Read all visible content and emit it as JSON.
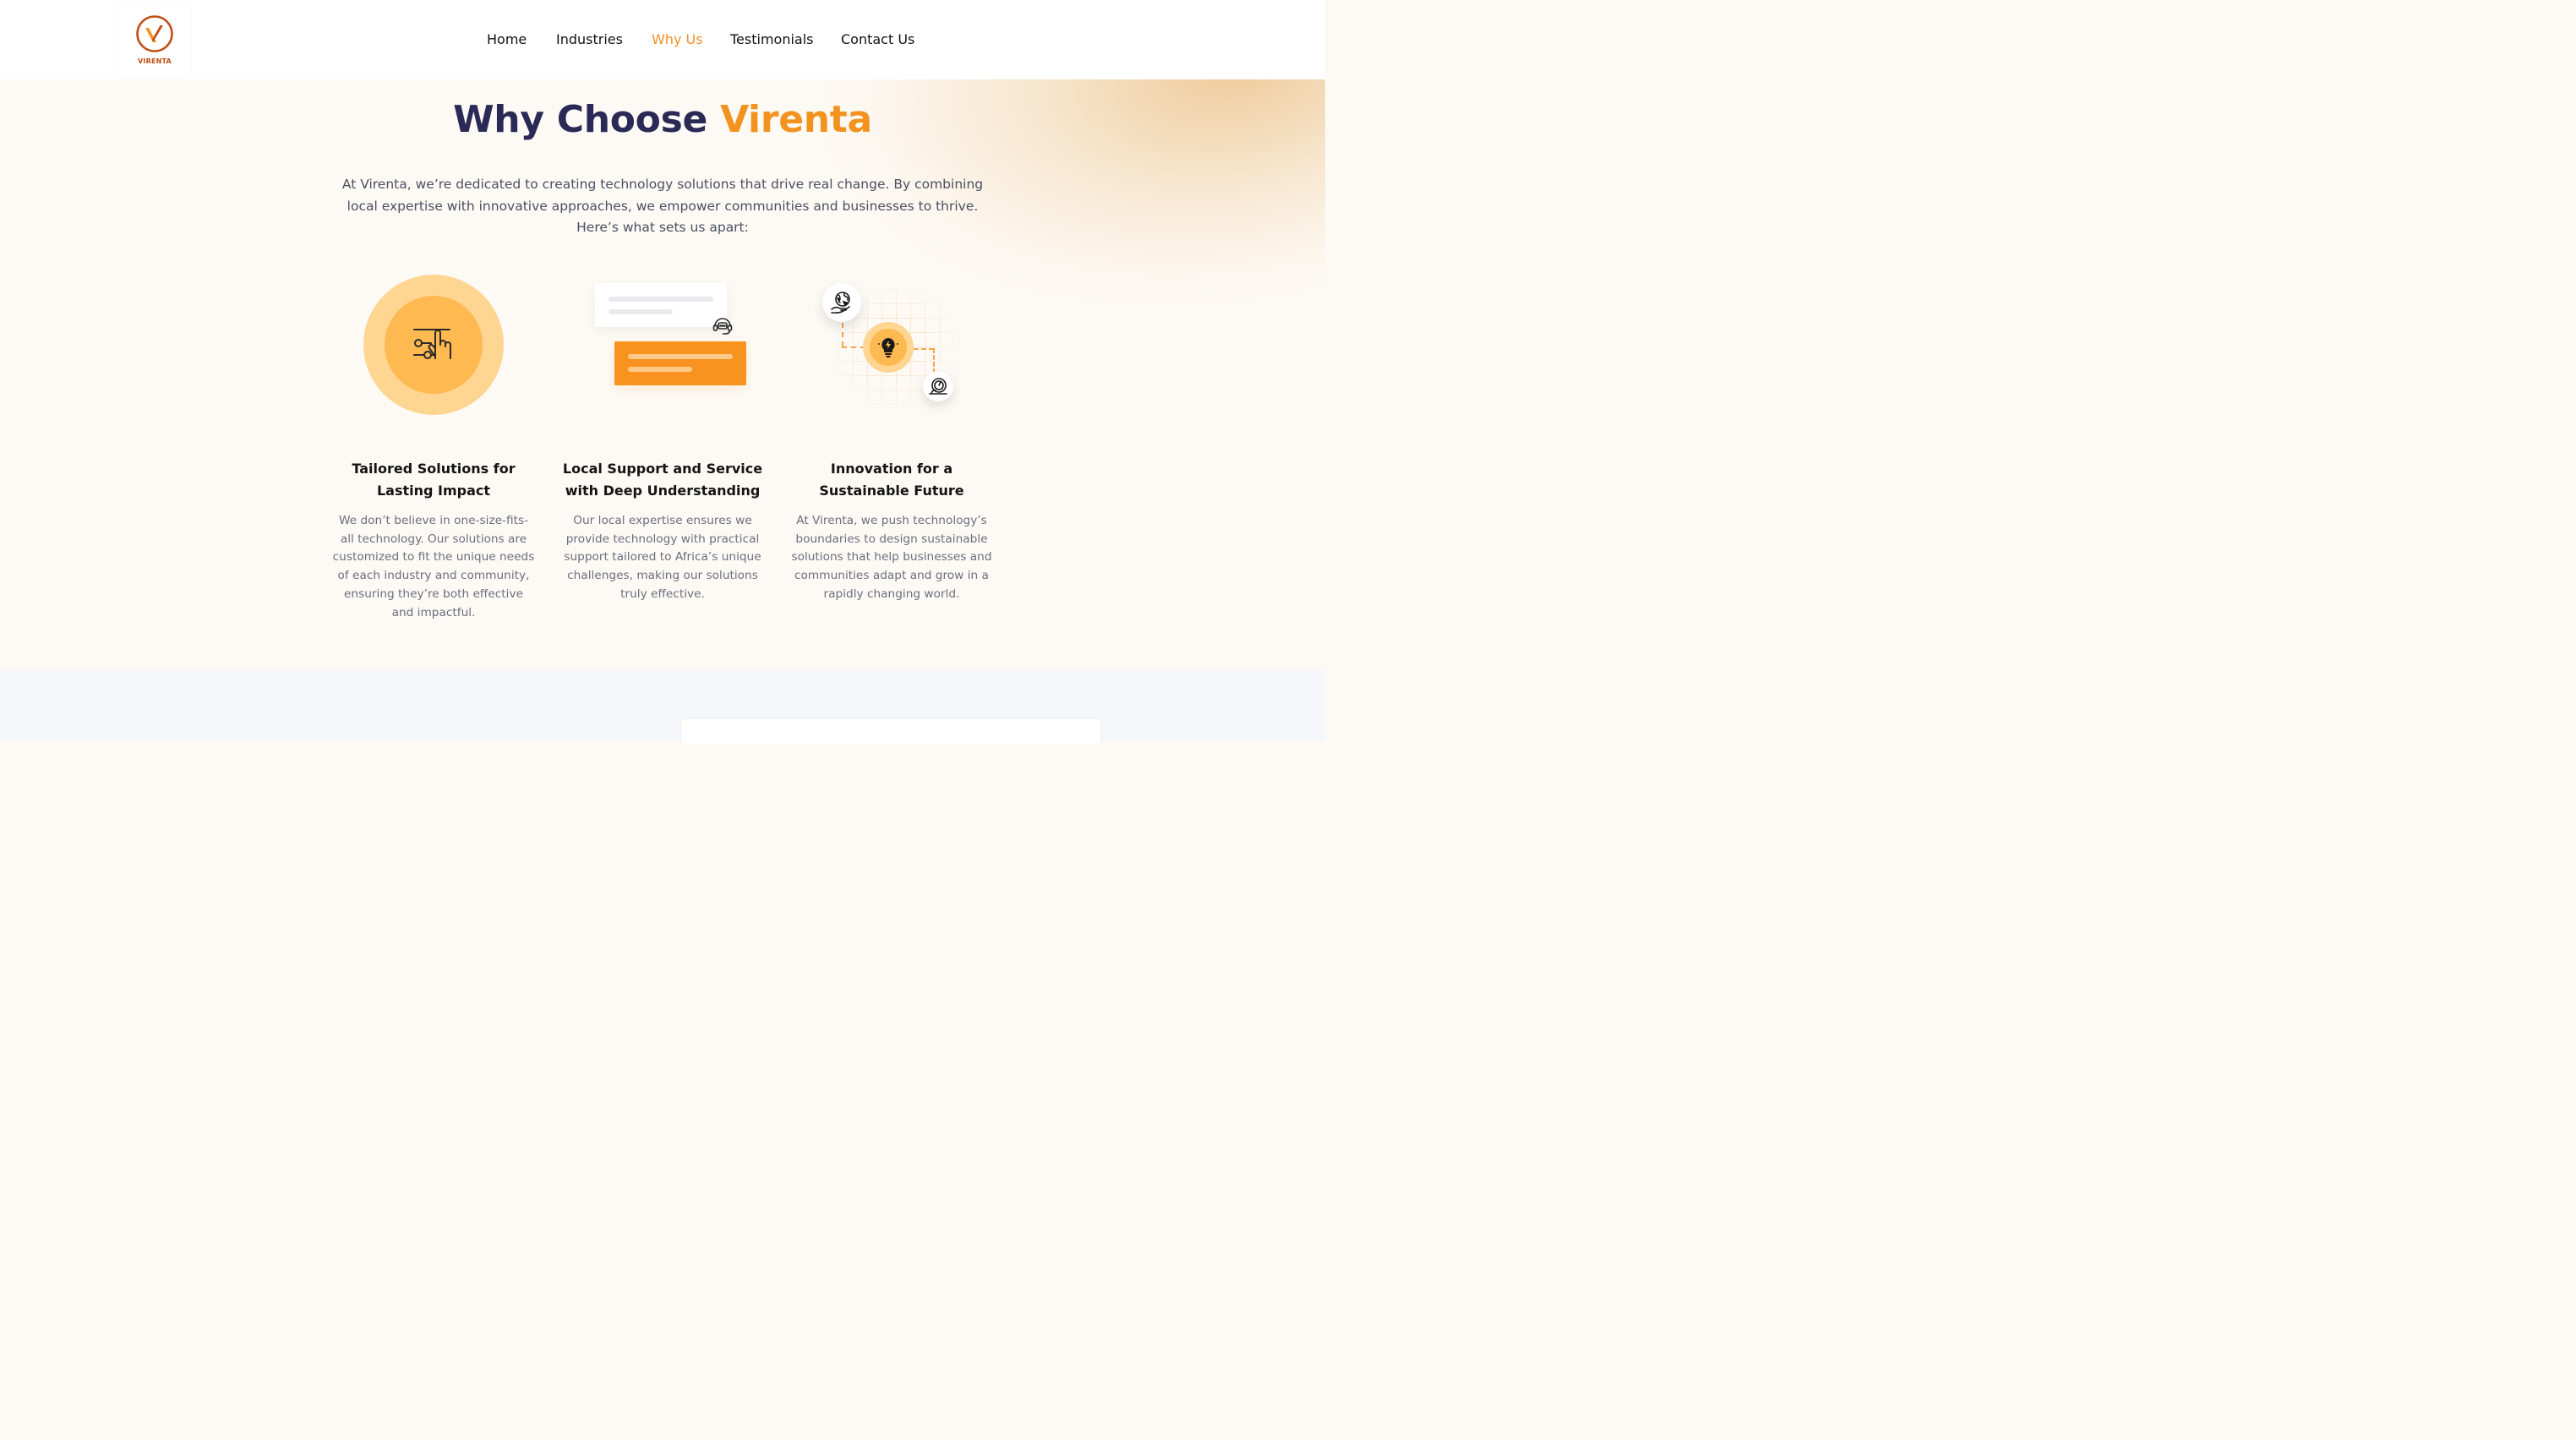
{
  "brand": {
    "logo_text": "VIRENTA",
    "logo_icon": "v-check-circle-icon",
    "colors": {
      "accent": "#f3931f",
      "navy": "#2b2a57",
      "logo": "#c14d15"
    }
  },
  "nav": {
    "items": [
      {
        "label": "Home"
      },
      {
        "label": "Industries"
      },
      {
        "label": "Why Us"
      },
      {
        "label": "Testimonials"
      },
      {
        "label": "Contact Us"
      }
    ],
    "active": "Why Us"
  },
  "hero": {
    "title_main": "Why Choose ",
    "title_accent": "Virenta",
    "intro": "At Virenta, we’re dedicated to creating technology solutions that drive real change. By combining local expertise with innovative approaches, we empower communities and businesses to thrive. Here’s what sets us apart:"
  },
  "features": [
    {
      "icon": "touch-sliders-icon",
      "title": "Tailored Solutions for Lasting Impact",
      "description": "We don’t believe in one-size-fits-all technology. Our solutions are customized to fit the unique needs of each industry and community, ensuring they’re both effective and impactful."
    },
    {
      "icon": "headset-support-icon",
      "title": "Local Support and Service with Deep Understanding",
      "description": "Our local expertise ensures we provide technology with practical support tailored to Africa’s unique challenges, making our solutions truly effective."
    },
    {
      "icon": "lightbulb-innovation-icon",
      "title": "Innovation for a Sustainable Future",
      "description": "At Virenta, we push technology’s boundaries to design sustainable solutions that help businesses and communities adapt and grow in a rapidly changing world."
    }
  ]
}
